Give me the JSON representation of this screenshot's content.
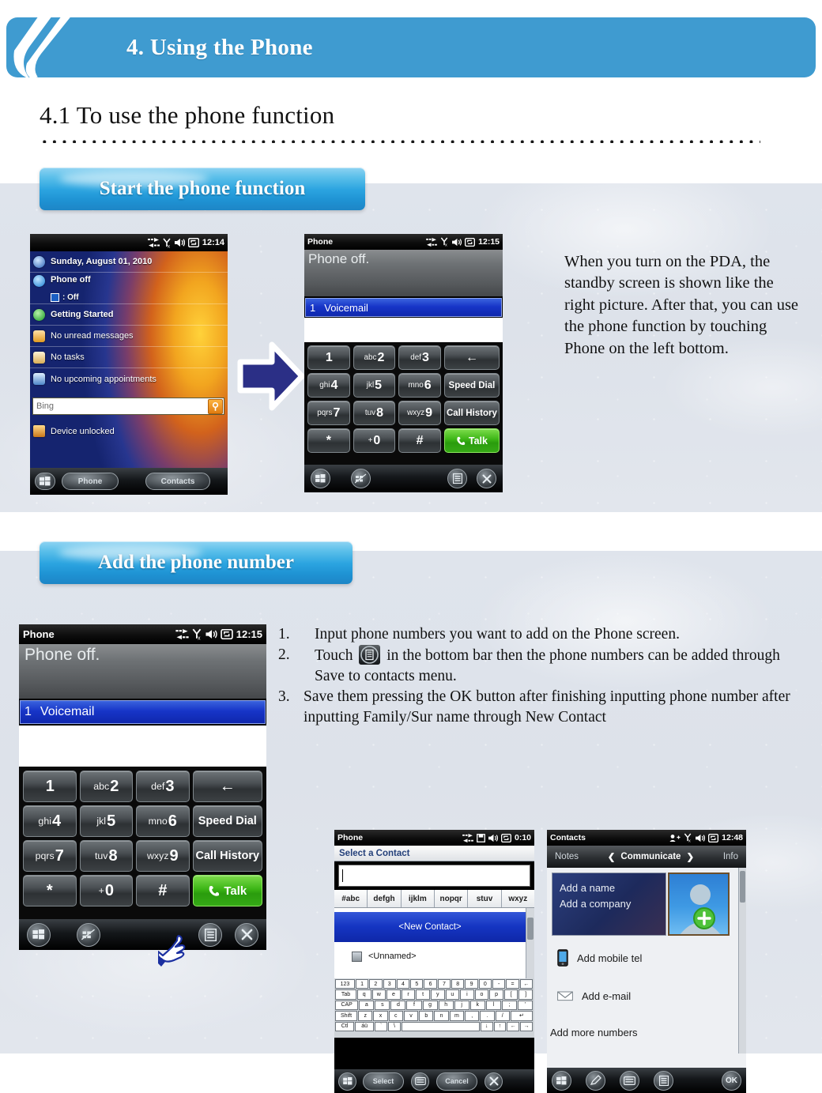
{
  "header": {
    "title": "4. Using the Phone",
    "logo_icon": "swoosh-logo"
  },
  "section": {
    "number_title": "4.1 To use the phone function"
  },
  "banners": {
    "start": "Start the phone function",
    "add": "Add the phone number"
  },
  "note": "When you turn on the PDA, the standby screen is shown like the right picture. After that, you can use the phone function by touching Phone on the left bottom.",
  "steps": [
    {
      "num": "1.",
      "text": "Input phone numbers you want to add on the Phone screen."
    },
    {
      "num": "2.",
      "pre": "Touch",
      "post": "in the bottom bar then the phone numbers can be added through Save to contacts menu.",
      "icon": "menu-icon"
    },
    {
      "num": "3.",
      "text": "Save them pressing the OK button after finishing inputting phone number after inputting Family/Sur name through New Contact"
    }
  ],
  "today_screen": {
    "statusbar": {
      "time": "12:14",
      "icons": [
        "data-transfer-icon",
        "signal-off-icon",
        "volume-icon",
        "sync-icon"
      ]
    },
    "rows": [
      {
        "label": "Sunday, August 01, 2010",
        "icon": "clock-icon",
        "bold": true
      },
      {
        "label": "Phone off",
        "icon": "phone-icon",
        "bold": true,
        "sub": ": Off",
        "sub_icon": "bluetooth-icon"
      },
      {
        "label": "Getting Started",
        "icon": "getting-started-icon",
        "bold": true
      },
      {
        "label": "No unread messages",
        "icon": "messages-icon",
        "bold": false
      },
      {
        "label": "No tasks",
        "icon": "tasks-icon",
        "bold": false
      },
      {
        "label": "No upcoming appointments",
        "icon": "calendar-icon",
        "bold": false
      }
    ],
    "search": {
      "value": "Bing",
      "go_icon": "search-icon"
    },
    "lock_row": {
      "label": "Device unlocked",
      "icon": "unlock-icon"
    },
    "softkeys": [
      {
        "label": "",
        "icon": "windows-start-icon"
      },
      {
        "label": "Phone",
        "icon": ""
      },
      {
        "label": "Contacts",
        "icon": ""
      }
    ]
  },
  "dialer_screen": {
    "title": "Phone",
    "statusbar": {
      "time": "12:15",
      "icons": [
        "data-transfer-icon",
        "signal-off-icon",
        "volume-icon",
        "sync-icon"
      ]
    },
    "status_text": "Phone off.",
    "voicemail": {
      "index": "1",
      "label": "Voicemail"
    },
    "keys": [
      [
        {
          "sub": "",
          "main": "1"
        },
        {
          "sub": "abc",
          "main": "2"
        },
        {
          "sub": "def",
          "main": "3"
        },
        {
          "sub": "",
          "main": "←",
          "wide": true
        }
      ],
      [
        {
          "sub": "ghi",
          "main": "4"
        },
        {
          "sub": "jkl",
          "main": "5"
        },
        {
          "sub": "mno",
          "main": "6"
        },
        {
          "sub": "",
          "main": "Speed Dial",
          "wide": true
        }
      ],
      [
        {
          "sub": "pqrs",
          "main": "7"
        },
        {
          "sub": "tuv",
          "main": "8"
        },
        {
          "sub": "wxyz",
          "main": "9"
        },
        {
          "sub": "",
          "main": "Call History",
          "wide": true
        }
      ],
      [
        {
          "sub": "",
          "main": "*"
        },
        {
          "sub": "+",
          "main": "0"
        },
        {
          "sub": "",
          "main": "#"
        },
        {
          "sub": "",
          "main": "Talk",
          "wide": true,
          "talk": true
        }
      ]
    ],
    "softkeys": [
      "windows-start-icon",
      "keyboard-off-icon",
      "menu-icon",
      "close-icon"
    ]
  },
  "select_contact_screen": {
    "title": "Phone",
    "statusbar": {
      "time": "0:10",
      "icons": [
        "data-transfer-icon",
        "save-icon",
        "volume-icon",
        "sync-icon"
      ]
    },
    "heading": "Select a Contact",
    "input_value": "",
    "alpha_tabs": [
      "#abc",
      "defgh",
      "ijklm",
      "nopqr",
      "stuv",
      "wxyz"
    ],
    "new_contact": "<New Contact>",
    "unnamed": "<Unnamed>",
    "keyboard_rows": [
      [
        "123",
        "1",
        "2",
        "3",
        "4",
        "5",
        "6",
        "7",
        "8",
        "9",
        "0",
        "-",
        "=",
        "←"
      ],
      [
        "Tab",
        "q",
        "w",
        "e",
        "r",
        "t",
        "y",
        "u",
        "i",
        "o",
        "p",
        "[",
        "]"
      ],
      [
        "CAP",
        "a",
        "s",
        "d",
        "f",
        "g",
        "h",
        "j",
        "k",
        "l",
        ";",
        "'"
      ],
      [
        "Shift",
        "z",
        "x",
        "c",
        "v",
        "b",
        "n",
        "m",
        ",",
        ".",
        "/",
        "↵"
      ],
      [
        "Ctl",
        "áü",
        "`",
        "\\",
        " ",
        "↓",
        "↑",
        "←",
        "→"
      ]
    ],
    "softkeys": [
      "windows-start-icon",
      "Select",
      "keyboard-icon",
      "Cancel",
      "close-icon"
    ]
  },
  "contacts_screen": {
    "title": "Contacts",
    "statusbar": {
      "time": "12:48",
      "icons": [
        "contact-add-icon",
        "signal-off-icon",
        "volume-icon",
        "sync-icon"
      ]
    },
    "tabs": {
      "left": "Notes",
      "center": "Communicate",
      "right": "Info"
    },
    "name_card": {
      "line1": "Add a name",
      "line2": "Add a company"
    },
    "photo_icon": "add-contact-photo-icon",
    "items": [
      {
        "label": "Add mobile tel",
        "icon": "mobile-phone-icon"
      },
      {
        "label": "Add e-mail",
        "icon": "envelope-icon"
      },
      {
        "label": "Add more numbers",
        "icon": ""
      }
    ],
    "softkeys": [
      "windows-start-icon",
      "edit-icon",
      "keyboard-icon",
      "menu-icon",
      "OK"
    ]
  },
  "flow_arrow": "right-arrow-icon",
  "colors": {
    "brand_blue": "#3f9bd0",
    "pill_blue": "#2ba4e0",
    "panel_bg": "#dfe4ec",
    "arrow_navy": "#2b2f86",
    "highlight_blue": "#1735c8",
    "talk_green": "#3cb516"
  }
}
